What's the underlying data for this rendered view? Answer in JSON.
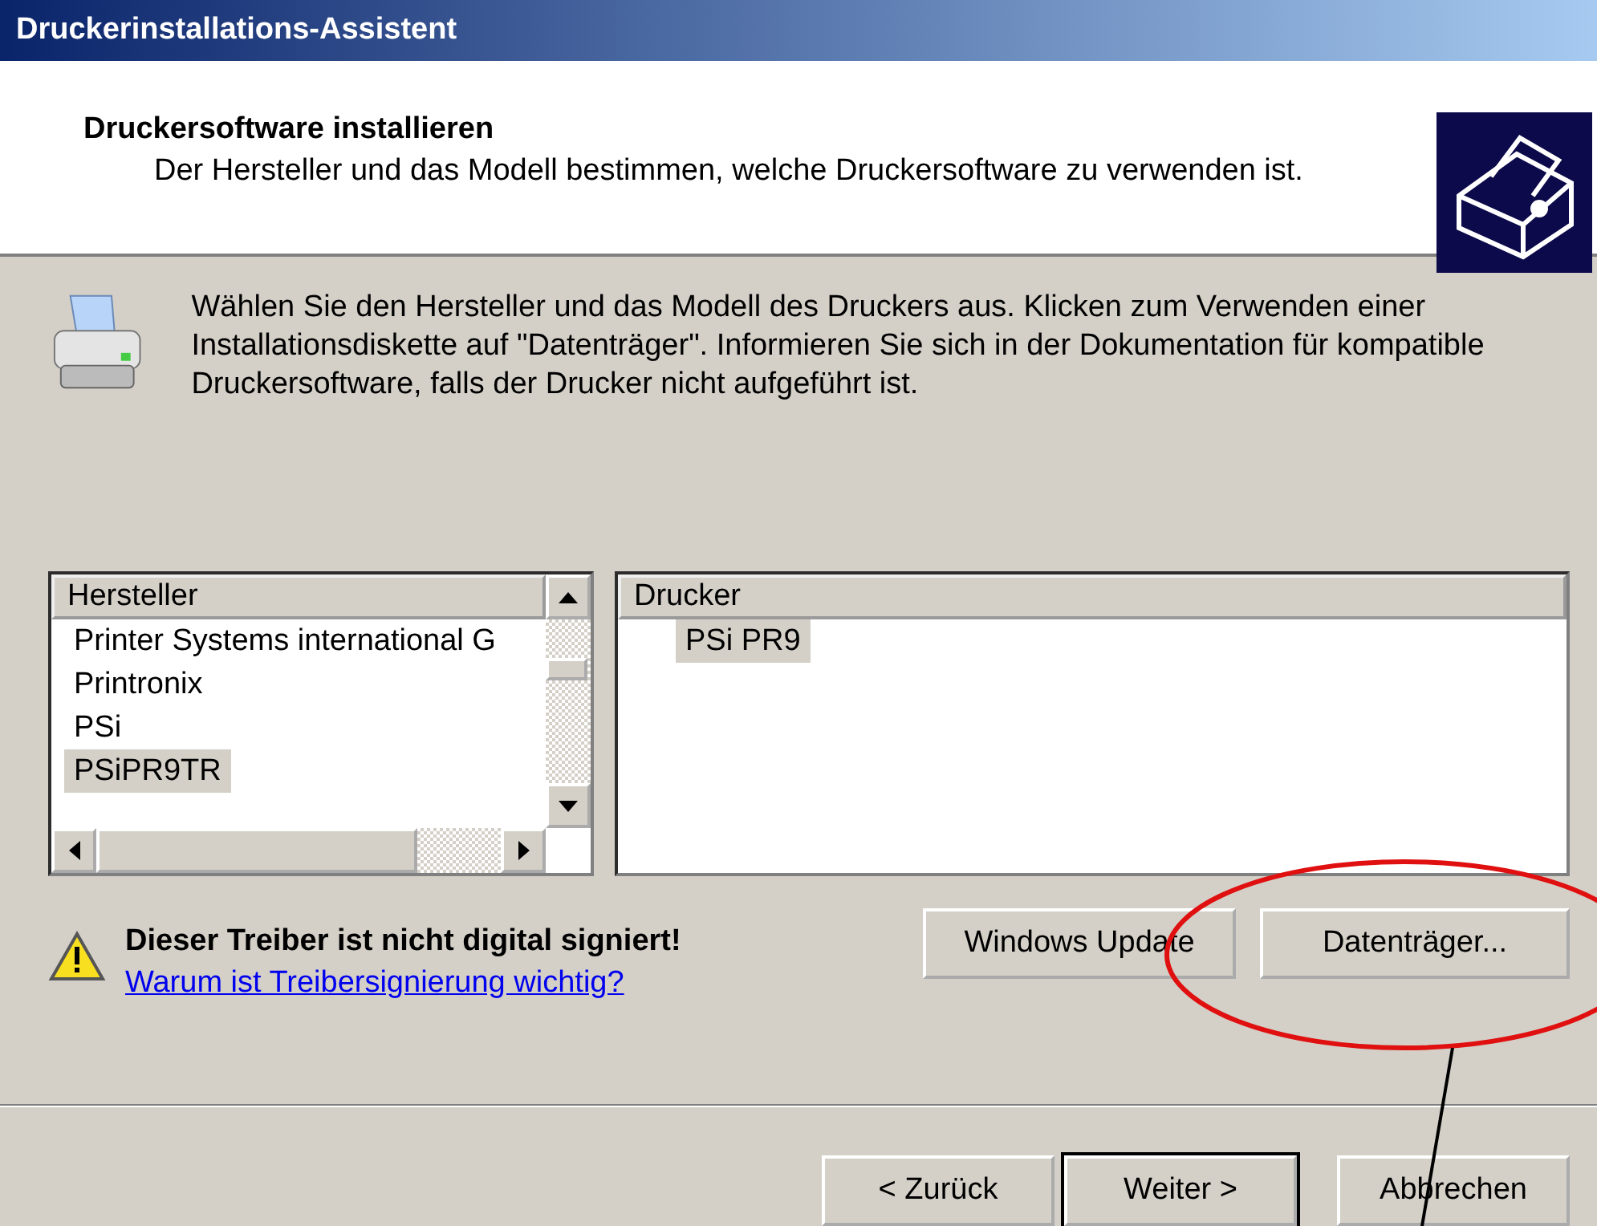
{
  "window": {
    "title": "Druckerinstallations-Assistent"
  },
  "header": {
    "title": "Druckersoftware installieren",
    "subtitle": "Der Hersteller und das Modell bestimmen, welche Druckersoftware zu verwenden ist."
  },
  "instructions": "Wählen Sie den Hersteller und das Modell des Druckers aus. Klicken zum Verwenden einer Installationsdiskette auf \"Datenträger\". Informieren Sie sich in der Dokumentation für kompatible Druckersoftware, falls der Drucker nicht aufgeführt ist.",
  "manufacturers": {
    "header": "Hersteller",
    "items": [
      {
        "label": "Printer Systems international G",
        "selected": false
      },
      {
        "label": "Printronix",
        "selected": false
      },
      {
        "label": "PSi",
        "selected": false
      },
      {
        "label": "PSiPR9TR",
        "selected": true
      }
    ]
  },
  "printers": {
    "header": "Drucker",
    "items": [
      {
        "label": "PSi PR9",
        "selected": true
      }
    ]
  },
  "warning": {
    "text": "Dieser Treiber ist nicht digital signiert!",
    "link": "Warum ist Treibersignierung wichtig?"
  },
  "side_buttons": [
    "Windows Update",
    "Datenträger..."
  ],
  "nav_buttons": [
    {
      "label": "< Zurück",
      "default": false
    },
    {
      "label": "Weiter >",
      "default": true
    },
    {
      "label": "Abbrechen",
      "default": false
    }
  ]
}
